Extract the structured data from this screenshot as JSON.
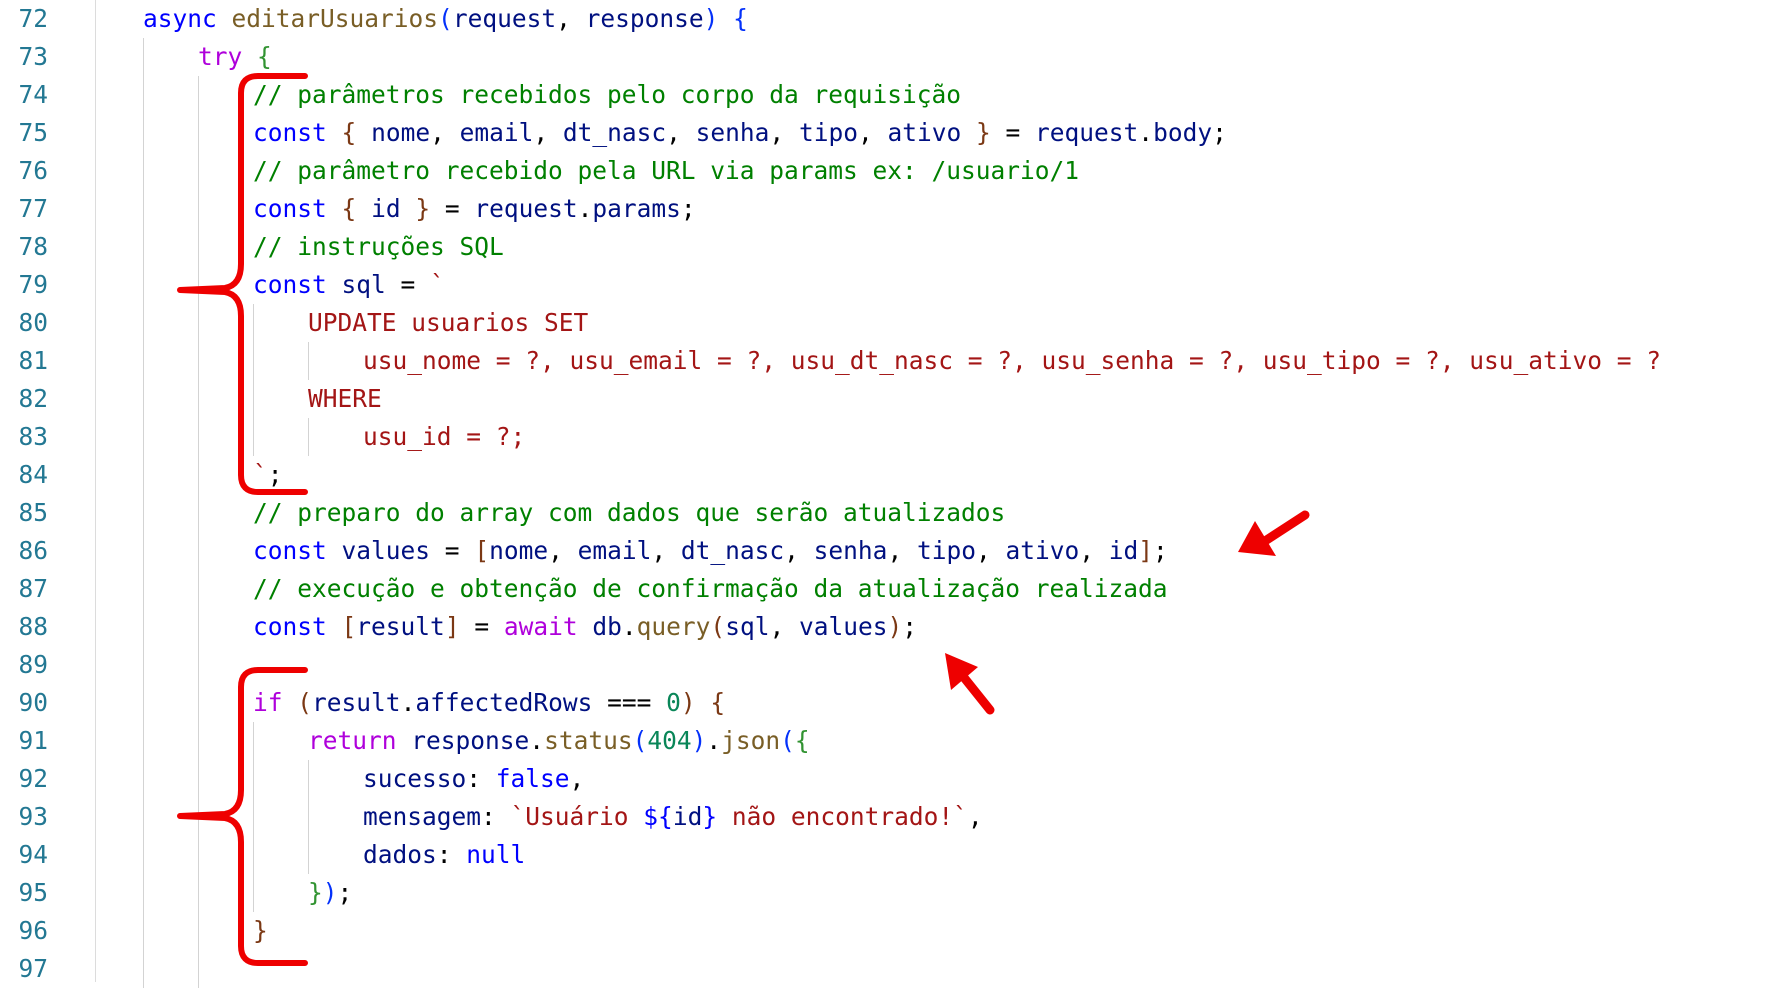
{
  "editor": {
    "lines": [
      {
        "num": "72",
        "indent": 1,
        "tokens": [
          [
            "k",
            "async"
          ],
          [
            "p",
            " "
          ],
          [
            "f",
            "editarUsuarios"
          ],
          [
            "b1",
            "("
          ],
          [
            "v",
            "request"
          ],
          [
            "p",
            ", "
          ],
          [
            "v",
            "response"
          ],
          [
            "b1",
            ")"
          ],
          [
            "p",
            " "
          ],
          [
            "b1",
            "{"
          ]
        ]
      },
      {
        "num": "73",
        "indent": 2,
        "tokens": [
          [
            "cf",
            "try"
          ],
          [
            "p",
            " "
          ],
          [
            "b2",
            "{"
          ]
        ]
      },
      {
        "num": "74",
        "indent": 3,
        "tokens": [
          [
            "c",
            "// parâmetros recebidos pelo corpo da requisição"
          ]
        ]
      },
      {
        "num": "75",
        "indent": 3,
        "tokens": [
          [
            "k",
            "const"
          ],
          [
            "p",
            " "
          ],
          [
            "b3",
            "{"
          ],
          [
            "p",
            " "
          ],
          [
            "v",
            "nome"
          ],
          [
            "p",
            ", "
          ],
          [
            "v",
            "email"
          ],
          [
            "p",
            ", "
          ],
          [
            "v",
            "dt_nasc"
          ],
          [
            "p",
            ", "
          ],
          [
            "v",
            "senha"
          ],
          [
            "p",
            ", "
          ],
          [
            "v",
            "tipo"
          ],
          [
            "p",
            ", "
          ],
          [
            "v",
            "ativo"
          ],
          [
            "p",
            " "
          ],
          [
            "b3",
            "}"
          ],
          [
            "p",
            " = "
          ],
          [
            "v",
            "request"
          ],
          [
            "p",
            "."
          ],
          [
            "v",
            "body"
          ],
          [
            "p",
            ";"
          ]
        ]
      },
      {
        "num": "76",
        "indent": 3,
        "tokens": [
          [
            "c",
            "// parâmetro recebido pela URL via params ex: /usuario/1"
          ]
        ]
      },
      {
        "num": "77",
        "indent": 3,
        "tokens": [
          [
            "k",
            "const"
          ],
          [
            "p",
            " "
          ],
          [
            "b3",
            "{"
          ],
          [
            "p",
            " "
          ],
          [
            "v",
            "id"
          ],
          [
            "p",
            " "
          ],
          [
            "b3",
            "}"
          ],
          [
            "p",
            " = "
          ],
          [
            "v",
            "request"
          ],
          [
            "p",
            "."
          ],
          [
            "v",
            "params"
          ],
          [
            "p",
            ";"
          ]
        ]
      },
      {
        "num": "78",
        "indent": 3,
        "tokens": [
          [
            "c",
            "// instruções SQL"
          ]
        ]
      },
      {
        "num": "79",
        "indent": 3,
        "tokens": [
          [
            "k",
            "const"
          ],
          [
            "p",
            " "
          ],
          [
            "v",
            "sql"
          ],
          [
            "p",
            " = "
          ],
          [
            "s",
            "`"
          ]
        ]
      },
      {
        "num": "80",
        "indent": 4,
        "tokens": [
          [
            "s",
            "UPDATE usuarios SET"
          ]
        ]
      },
      {
        "num": "81",
        "indent": 5,
        "tokens": [
          [
            "s",
            "usu_nome = ?, usu_email = ?, usu_dt_nasc = ?, usu_senha = ?, usu_tipo = ?, usu_ativo = ?"
          ]
        ]
      },
      {
        "num": "82",
        "indent": 4,
        "tokens": [
          [
            "s",
            "WHERE"
          ]
        ]
      },
      {
        "num": "83",
        "indent": 5,
        "tokens": [
          [
            "s",
            "usu_id = ?;"
          ]
        ]
      },
      {
        "num": "84",
        "indent": 3,
        "tokens": [
          [
            "s",
            "`"
          ],
          [
            "p",
            ";"
          ]
        ]
      },
      {
        "num": "85",
        "indent": 3,
        "tokens": [
          [
            "c",
            "// preparo do array com dados que serão atualizados"
          ]
        ]
      },
      {
        "num": "86",
        "indent": 3,
        "tokens": [
          [
            "k",
            "const"
          ],
          [
            "p",
            " "
          ],
          [
            "v",
            "values"
          ],
          [
            "p",
            " = "
          ],
          [
            "b3",
            "["
          ],
          [
            "v",
            "nome"
          ],
          [
            "p",
            ", "
          ],
          [
            "v",
            "email"
          ],
          [
            "p",
            ", "
          ],
          [
            "v",
            "dt_nasc"
          ],
          [
            "p",
            ", "
          ],
          [
            "v",
            "senha"
          ],
          [
            "p",
            ", "
          ],
          [
            "v",
            "tipo"
          ],
          [
            "p",
            ", "
          ],
          [
            "v",
            "ativo"
          ],
          [
            "p",
            ", "
          ],
          [
            "v",
            "id"
          ],
          [
            "b3",
            "]"
          ],
          [
            "p",
            ";"
          ]
        ]
      },
      {
        "num": "87",
        "indent": 3,
        "tokens": [
          [
            "c",
            "// execução e obtenção de confirmação da atualização realizada"
          ]
        ]
      },
      {
        "num": "88",
        "indent": 3,
        "tokens": [
          [
            "k",
            "const"
          ],
          [
            "p",
            " "
          ],
          [
            "b3",
            "["
          ],
          [
            "v",
            "result"
          ],
          [
            "b3",
            "]"
          ],
          [
            "p",
            " = "
          ],
          [
            "cf",
            "await"
          ],
          [
            "p",
            " "
          ],
          [
            "v",
            "db"
          ],
          [
            "p",
            "."
          ],
          [
            "f",
            "query"
          ],
          [
            "b3",
            "("
          ],
          [
            "v",
            "sql"
          ],
          [
            "p",
            ", "
          ],
          [
            "v",
            "values"
          ],
          [
            "b3",
            ")"
          ],
          [
            "p",
            ";"
          ]
        ]
      },
      {
        "num": "89",
        "indent": 3,
        "tokens": []
      },
      {
        "num": "90",
        "indent": 3,
        "tokens": [
          [
            "cf",
            "if"
          ],
          [
            "p",
            " "
          ],
          [
            "b3",
            "("
          ],
          [
            "v",
            "result"
          ],
          [
            "p",
            "."
          ],
          [
            "v",
            "affectedRows"
          ],
          [
            "p",
            " === "
          ],
          [
            "n",
            "0"
          ],
          [
            "b3",
            ")"
          ],
          [
            "p",
            " "
          ],
          [
            "b3",
            "{"
          ]
        ]
      },
      {
        "num": "91",
        "indent": 4,
        "tokens": [
          [
            "cf",
            "return"
          ],
          [
            "p",
            " "
          ],
          [
            "v",
            "response"
          ],
          [
            "p",
            "."
          ],
          [
            "f",
            "status"
          ],
          [
            "b1",
            "("
          ],
          [
            "n",
            "404"
          ],
          [
            "b1",
            ")"
          ],
          [
            "p",
            "."
          ],
          [
            "f",
            "json"
          ],
          [
            "b1",
            "("
          ],
          [
            "b2",
            "{"
          ]
        ]
      },
      {
        "num": "92",
        "indent": 5,
        "tokens": [
          [
            "v",
            "sucesso"
          ],
          [
            "p",
            ": "
          ],
          [
            "k",
            "false"
          ],
          [
            "p",
            ","
          ]
        ]
      },
      {
        "num": "93",
        "indent": 5,
        "tokens": [
          [
            "v",
            "mensagem"
          ],
          [
            "p",
            ": "
          ],
          [
            "s",
            "`Usuário "
          ],
          [
            "tp",
            "${"
          ],
          [
            "v",
            "id"
          ],
          [
            "tp",
            "}"
          ],
          [
            "s",
            " não encontrado!`"
          ],
          [
            "p",
            ","
          ]
        ]
      },
      {
        "num": "94",
        "indent": 5,
        "tokens": [
          [
            "v",
            "dados"
          ],
          [
            "p",
            ": "
          ],
          [
            "k",
            "null"
          ]
        ]
      },
      {
        "num": "95",
        "indent": 4,
        "tokens": [
          [
            "b2",
            "}"
          ],
          [
            "b1",
            ")"
          ],
          [
            "p",
            ";"
          ]
        ]
      },
      {
        "num": "96",
        "indent": 3,
        "tokens": [
          [
            "b3",
            "}"
          ]
        ]
      },
      {
        "num": "97",
        "indent": 3,
        "tokens": []
      }
    ]
  },
  "annotations": {
    "color": "#ee0000",
    "items": [
      "brace-sql-block",
      "brace-if-block",
      "arrow-values-array",
      "arrow-query-call"
    ]
  }
}
